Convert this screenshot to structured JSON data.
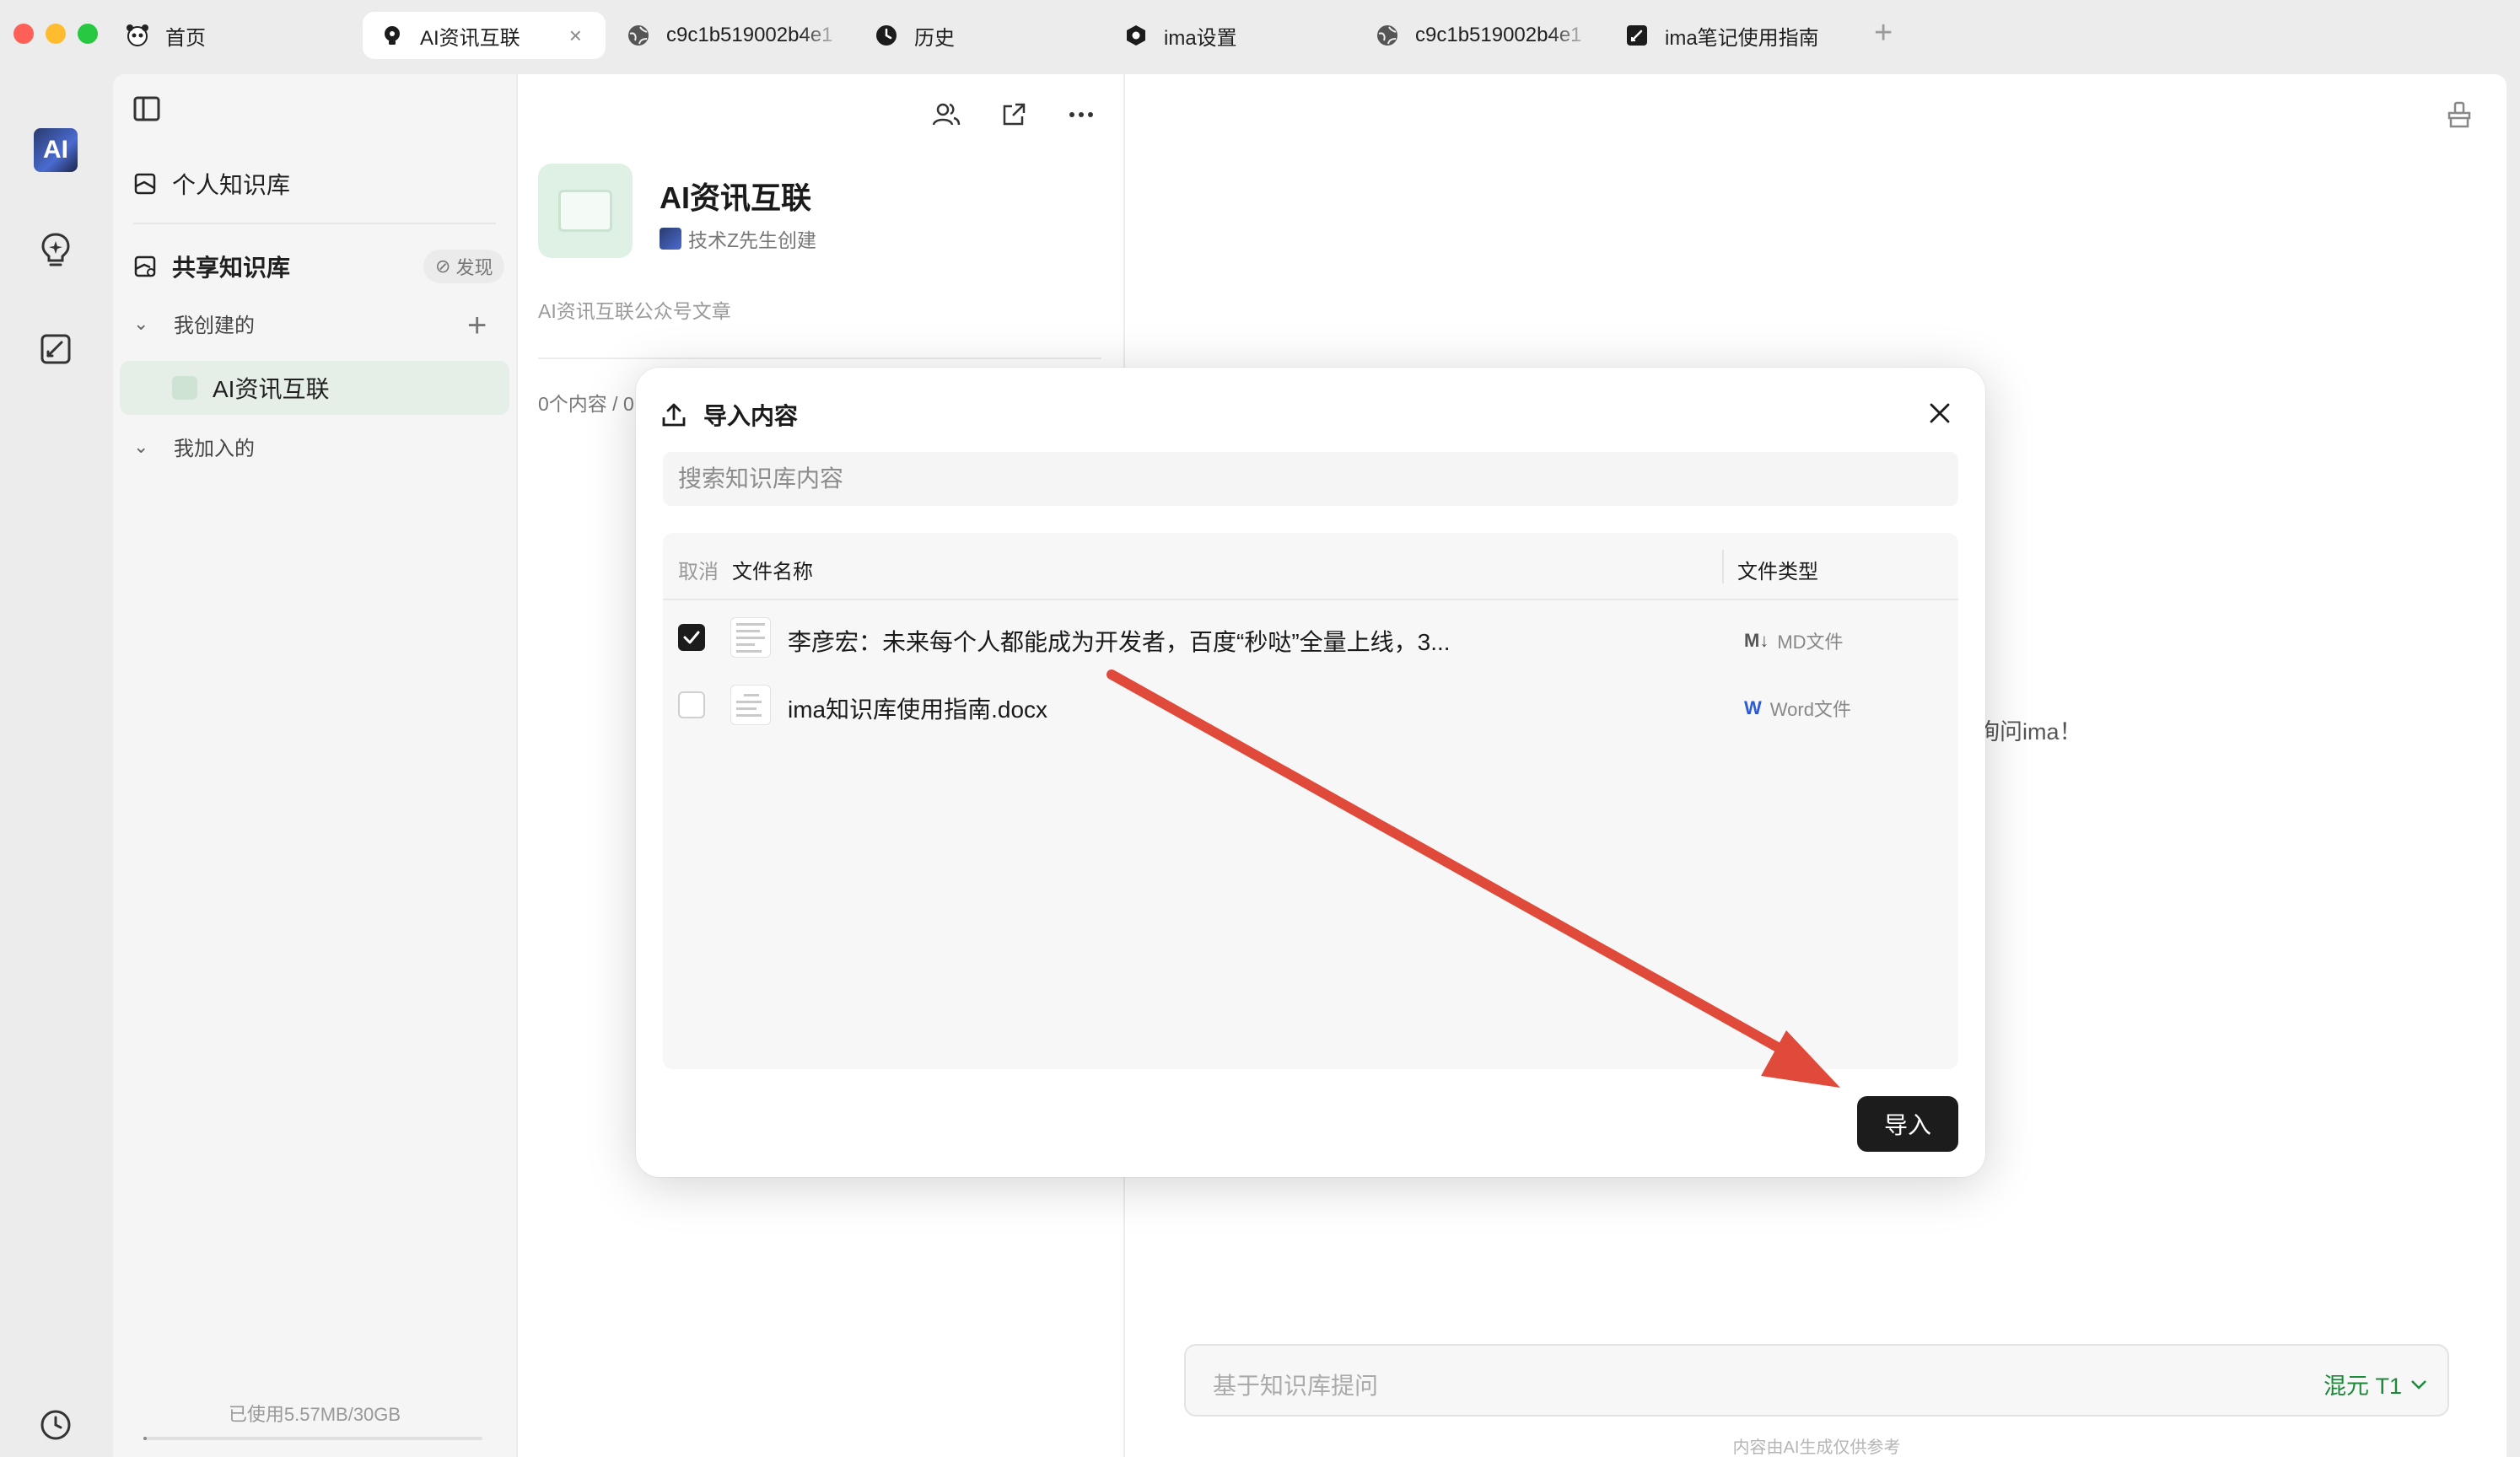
{
  "tabs": [
    {
      "label": "首页",
      "icon": "panda-icon"
    },
    {
      "label": "AI资讯互联",
      "icon": "bulb-icon",
      "active": true,
      "close": "×"
    },
    {
      "label": "c9c1b519002b4e1",
      "icon": "globe-icon"
    },
    {
      "label": "历史",
      "icon": "clock-icon"
    },
    {
      "label": "ima设置",
      "icon": "settings-icon"
    },
    {
      "label": "c9c1b519002b4e1",
      "icon": "globe-icon"
    },
    {
      "label": "ima笔记使用指南",
      "icon": "note-icon"
    }
  ],
  "new_tab": "+",
  "rail": {
    "avatar_text": "AI"
  },
  "sidebar": {
    "personal_kb": "个人知识库",
    "shared_kb": "共享知识库",
    "discover": "发现",
    "created_section": "我创建的",
    "joined_section": "我加入的",
    "selected_kb": "AI资讯互联",
    "storage": "已使用5.57MB/30GB",
    "storage_used_fraction": 0.0002
  },
  "detail": {
    "title": "AI资讯互联",
    "creator": "技术Z先生创建",
    "description": "AI资讯互联公众号文章",
    "count": "0个内容 / 0"
  },
  "chat": {
    "welcome": "询问ima！",
    "input_placeholder": "基于知识库提问",
    "model": "混元 T1",
    "footer_note": "内容由AI生成仅供参考"
  },
  "modal": {
    "title": "导入内容",
    "search_placeholder": "搜索知识库内容",
    "header_cancel": "取消",
    "header_name": "文件名称",
    "header_type": "文件类型",
    "rows": [
      {
        "name": "李彦宏：未来每个人都能成为开发者，百度“秒哒”全量上线，3...",
        "type": "MD文件",
        "type_icon": "M↓",
        "checked": true
      },
      {
        "name": "ima知识库使用指南.docx",
        "type": "Word文件",
        "type_icon": "W",
        "checked": false
      }
    ],
    "import_button": "导入"
  },
  "colors": {
    "accent_green": "#1d8a3a",
    "annotation_red": "#e04a3a",
    "dark_button": "#1c1c1c"
  }
}
